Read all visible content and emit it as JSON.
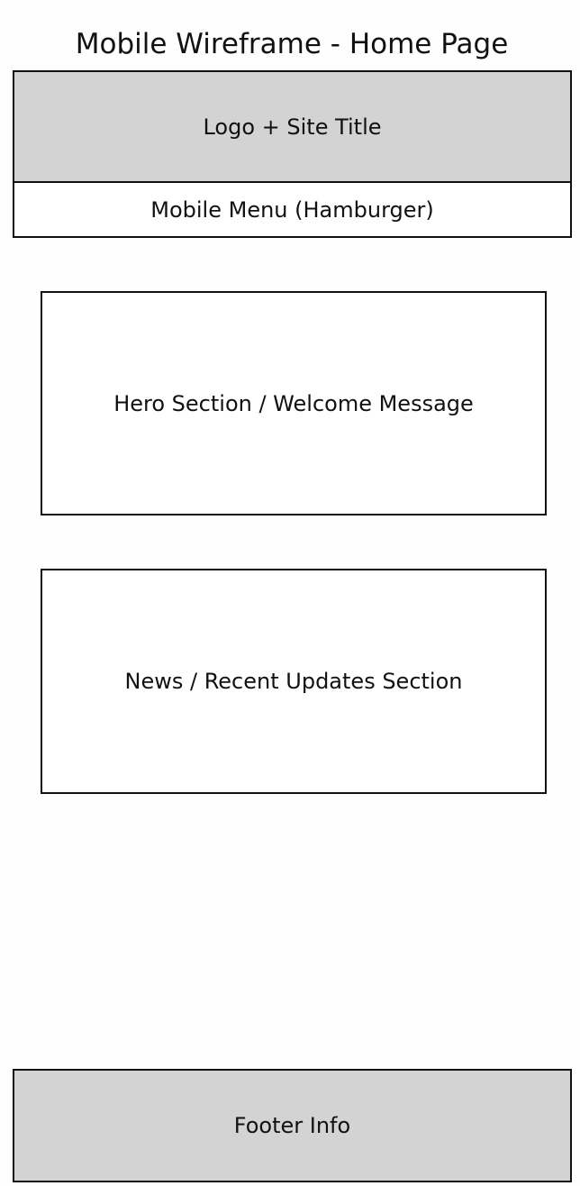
{
  "title": "Mobile Wireframe - Home Page",
  "header": {
    "label": "Logo + Site Title"
  },
  "menu": {
    "label": "Mobile Menu (Hamburger)"
  },
  "hero": {
    "label": "Hero Section / Welcome Message"
  },
  "news": {
    "label": "News / Recent Updates Section"
  },
  "footer": {
    "label": "Footer Info"
  },
  "colors": {
    "header_fill": "#d3d3d3",
    "footer_fill": "#d3d3d3",
    "border": "#111111",
    "background": "#fefefe"
  }
}
